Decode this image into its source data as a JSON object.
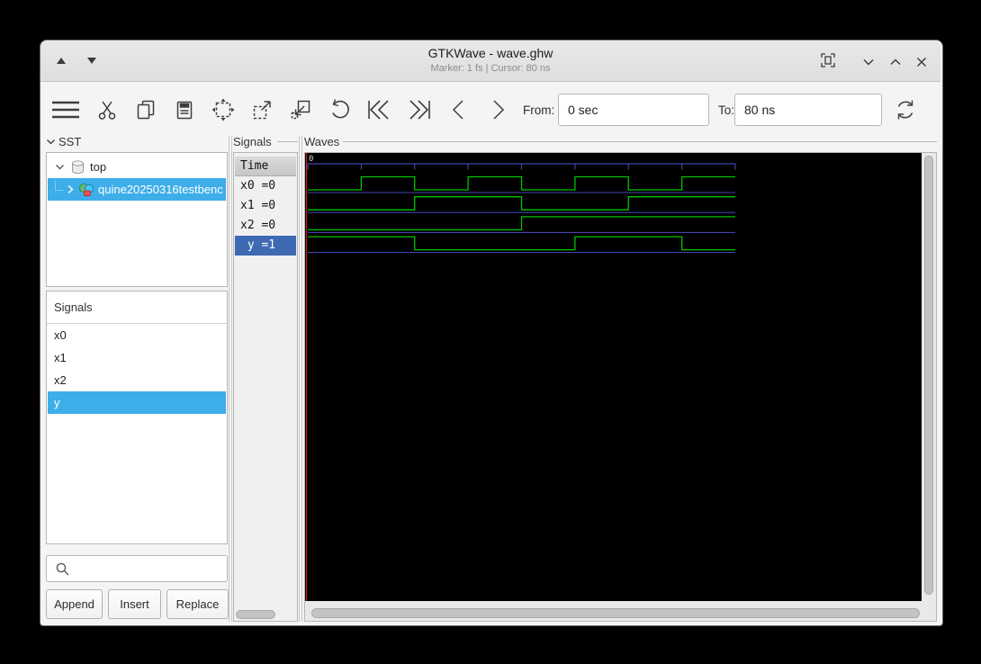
{
  "window": {
    "title": "GTKWave - wave.ghw",
    "subtitle": "Marker: 1 fs  |  Cursor: 80 ns"
  },
  "toolbar": {
    "from_label": "From:",
    "from_value": "0 sec",
    "to_label": "To:",
    "to_value": "80 ns"
  },
  "sst_panel": {
    "header": "SST",
    "tree": [
      {
        "label": "top"
      },
      {
        "label": "quine20250316testbenc"
      }
    ]
  },
  "facilities_panel": {
    "header": "Signals",
    "items": [
      "x0",
      "x1",
      "x2",
      "y"
    ],
    "selected": "y",
    "buttons": {
      "append": "Append",
      "insert": "Insert",
      "replace": "Replace"
    }
  },
  "signals_panel": {
    "frame_label": "Signals",
    "time_header": "Time",
    "rows": [
      {
        "text": "x0 =0"
      },
      {
        "text": "x1 =0"
      },
      {
        "text": "x2 =0"
      },
      {
        "text": " y =1"
      }
    ],
    "selected_index": 3
  },
  "waves_panel": {
    "frame_label": "Waves",
    "origin_label": "0"
  },
  "colors": {
    "tree_selection": "#3daee9",
    "signal_row_selection": "#3d6ab2"
  },
  "chart_data": {
    "type": "digital-waveform",
    "title": "GHW simulation waves",
    "time_unit": "ns",
    "t_start": 0,
    "t_end": 80,
    "ruler_ticks_ns": [
      0,
      10,
      20,
      30,
      40,
      50,
      60,
      70,
      80
    ],
    "marker_time": "1 fs",
    "cursor_time": "80 ns",
    "signals": [
      {
        "name": "x0",
        "initial": 0,
        "toggles_ns": [
          10,
          20,
          30,
          40,
          50,
          60,
          70
        ],
        "value_at_marker": 0
      },
      {
        "name": "x1",
        "initial": 0,
        "toggles_ns": [
          20,
          40,
          60
        ],
        "value_at_marker": 0
      },
      {
        "name": "x2",
        "initial": 0,
        "toggles_ns": [
          40
        ],
        "value_at_marker": 0
      },
      {
        "name": "y",
        "initial": 1,
        "toggles_ns": [
          20,
          50,
          70
        ],
        "value_at_marker": 1
      }
    ],
    "colors": {
      "trace": "#00c400",
      "baseline": "#4343ad",
      "ruler": "#4343ad",
      "marker_line": "#c81d1d",
      "background": "#000000"
    }
  }
}
